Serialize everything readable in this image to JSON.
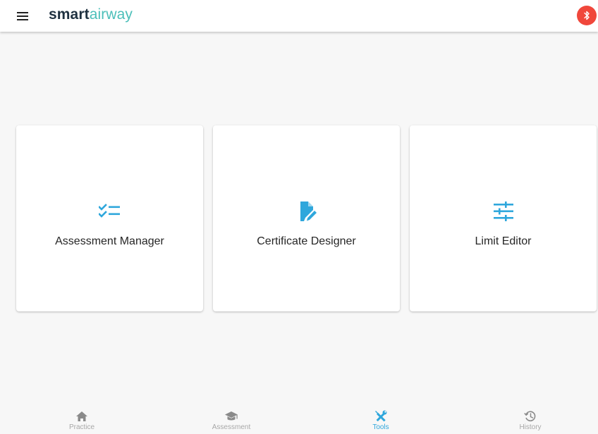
{
  "app": {
    "logo_part1": "smart",
    "logo_part2": "airway"
  },
  "colors": {
    "accent": "#2fa7dc",
    "logo_dark": "#1f3140",
    "logo_teal": "#4bbfb9",
    "bluetooth_badge": "#f0473b",
    "inactive_nav": "#a8a8a8"
  },
  "header": {
    "menu_icon": "menu-icon",
    "bluetooth_icon": "bluetooth-icon"
  },
  "tools": [
    {
      "label": "Assessment Manager",
      "icon": "checklist-icon"
    },
    {
      "label": "Certificate Designer",
      "icon": "edit-document-icon"
    },
    {
      "label": "Limit Editor",
      "icon": "sliders-icon"
    }
  ],
  "bottom_nav": [
    {
      "label": "Practice",
      "icon": "home-icon",
      "active": false
    },
    {
      "label": "Assessment",
      "icon": "graduation-cap-icon",
      "active": false
    },
    {
      "label": "Tools",
      "icon": "tools-icon",
      "active": true
    },
    {
      "label": "History",
      "icon": "history-icon",
      "active": false
    }
  ]
}
